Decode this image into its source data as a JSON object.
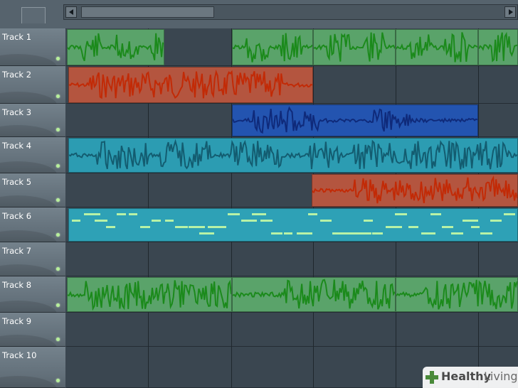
{
  "tracks": [
    {
      "name": "Track 1",
      "label": "Track 1"
    },
    {
      "name": "Track 2",
      "label": "Track 2"
    },
    {
      "name": "Track 3",
      "label": "Track 3"
    },
    {
      "name": "Track 4",
      "label": "Track 4"
    },
    {
      "name": "Track 5",
      "label": "Track 5"
    },
    {
      "name": "Track 6",
      "label": "Track 6"
    },
    {
      "name": "Track 7",
      "label": "Track 7"
    },
    {
      "name": "Track 8",
      "label": "Track 8"
    },
    {
      "name": "Track 9",
      "label": "Track 9"
    },
    {
      "name": "Track 10",
      "label": "Track 10"
    }
  ],
  "clip_colors": {
    "green": "#5aa36a",
    "green_wave": "#1b8a1b",
    "red": "#b4553f",
    "red_wave": "#c22a06",
    "blue": "#2354b0",
    "blue_wave": "#0f2a7a",
    "teal": "#2c9cb2",
    "teal_wave": "#135c70",
    "pattern": "#2ea1b6",
    "pattern_notes": "#b8f2a6"
  },
  "watermark": {
    "brand": "Healthy",
    "brand2": "Living"
  }
}
